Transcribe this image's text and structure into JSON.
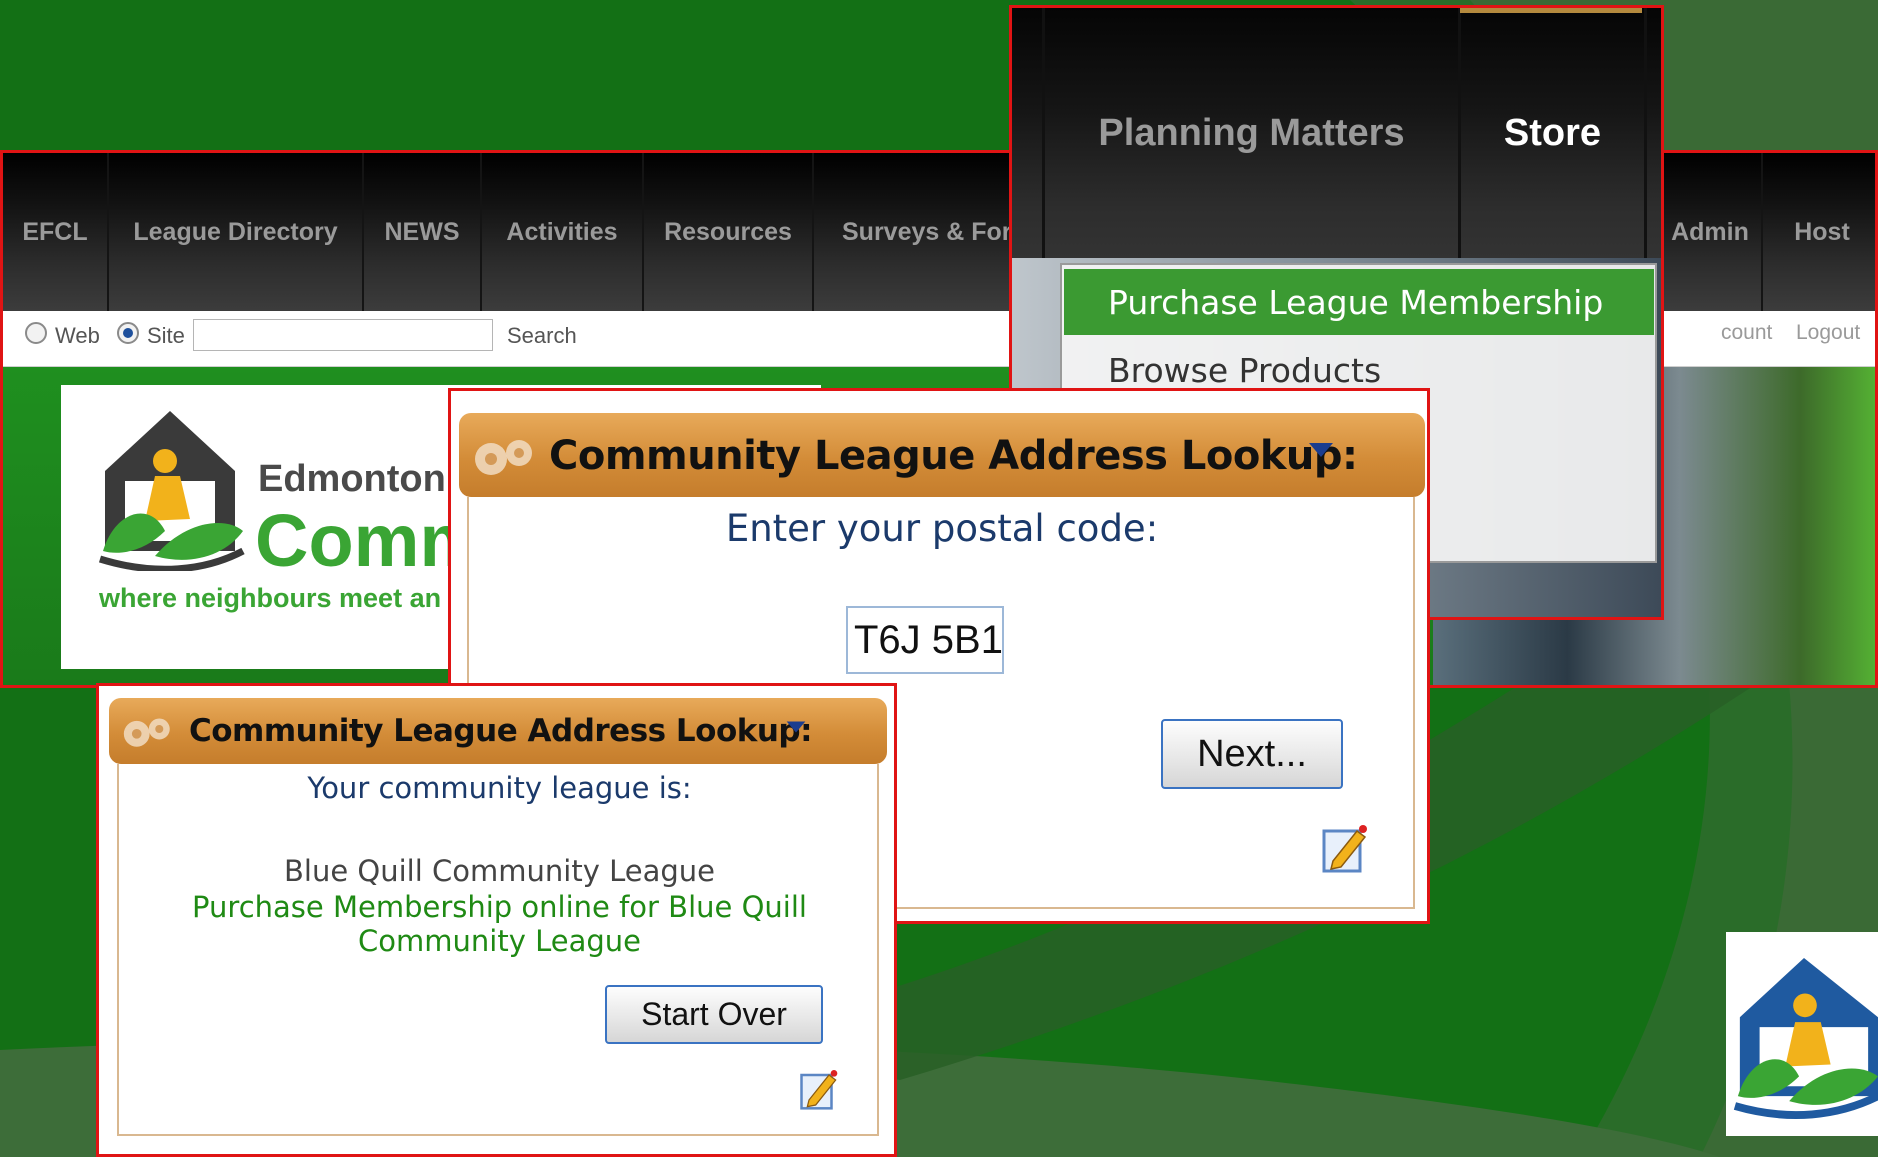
{
  "site": {
    "nav": [
      "EFCL",
      "League Directory",
      "NEWS",
      "Activities",
      "Resources",
      "Surveys & For",
      "Admin",
      "Host"
    ],
    "search": {
      "web_label": "Web",
      "site_label": "Site",
      "button_label": "Search",
      "value": "",
      "selected": "Site"
    },
    "account_links": [
      "count",
      "Logout"
    ],
    "logo": {
      "title": "Edmonton Fed",
      "big": "Commu",
      "tagline": "where neighbours meet an"
    }
  },
  "menu": {
    "top_items": [
      "Planning Matters",
      "Store"
    ],
    "dropdown": [
      "Purchase League Membership",
      "Browse Products"
    ],
    "active_color": "#3b9a32"
  },
  "lookup_step1": {
    "title": "Community League Address Lookup:",
    "prompt": "Enter your postal code:",
    "postal_code": "T6J 5B1",
    "next_label": "Next..."
  },
  "lookup_step2": {
    "title": "Community League Address Lookup:",
    "result_label": "Your community league is:",
    "league_name": "Blue Quill Community League",
    "purchase_link_line1": "Purchase Membership online for Blue Quill",
    "purchase_link_line2": "Community League",
    "start_over_label": "Start Over"
  },
  "colors": {
    "background": "#137015",
    "highlight_border": "#e01414",
    "header_orange": "#d38c38",
    "link_green": "#1f8a14",
    "prompt_blue": "#1b3a6b"
  },
  "icons": [
    "edit-pencil-icon",
    "dropdown-caret-icon",
    "gears-icon",
    "league-house-logo"
  ]
}
